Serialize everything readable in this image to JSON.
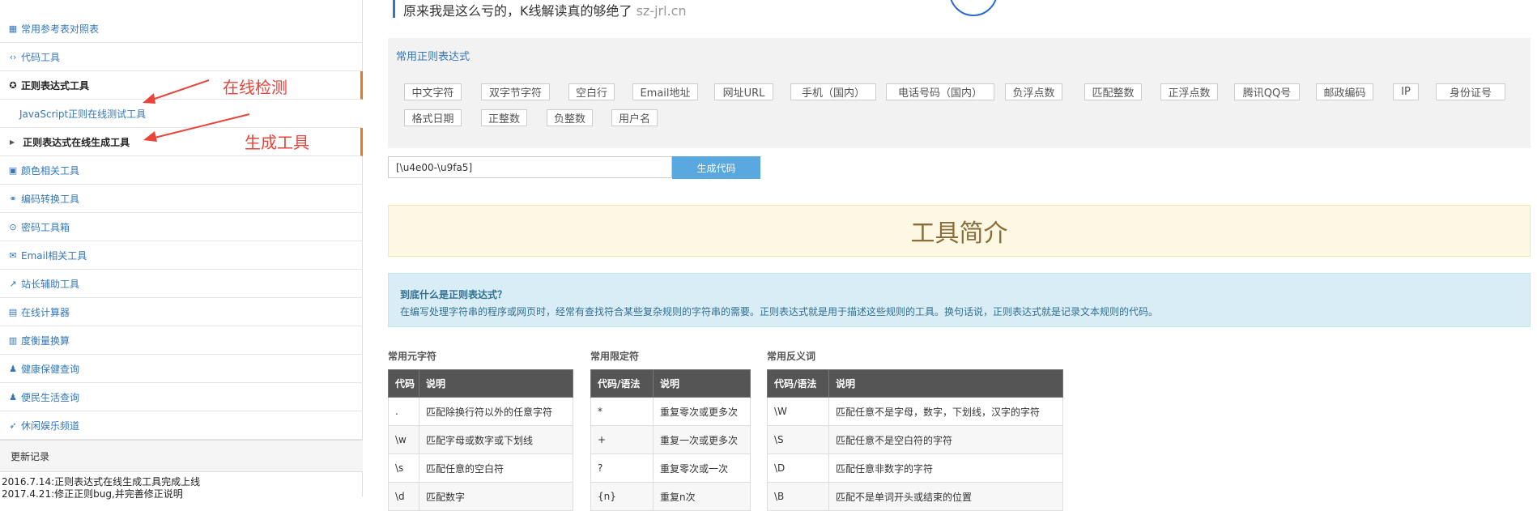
{
  "sidebar": {
    "items": [
      {
        "icon": "table-icon",
        "glyph": "▦",
        "label": "常用参考表对照表"
      },
      {
        "icon": "code-icon",
        "glyph": "‹›",
        "label": "代码工具"
      },
      {
        "icon": "regex-icon",
        "glyph": "✪",
        "label": "正则表达式工具"
      },
      {
        "icon": "palette-icon",
        "glyph": "▣",
        "label": "颜色相关工具"
      },
      {
        "icon": "convert-icon",
        "glyph": "⚭",
        "label": "编码转换工具"
      },
      {
        "icon": "password-icon",
        "glyph": "⊙",
        "label": "密码工具箱"
      },
      {
        "icon": "email-icon",
        "glyph": "✉",
        "label": "Email相关工具"
      },
      {
        "icon": "share-icon",
        "glyph": "↗",
        "label": "站长辅助工具"
      },
      {
        "icon": "calculator-icon",
        "glyph": "▤",
        "label": "在线计算器"
      },
      {
        "icon": "measure-icon",
        "glyph": "▥",
        "label": "度衡量换算"
      },
      {
        "icon": "health-icon",
        "glyph": "♟",
        "label": "健康保健查询"
      },
      {
        "icon": "life-icon",
        "glyph": "♟",
        "label": "便民生活查询"
      },
      {
        "icon": "game-icon",
        "glyph": "➶",
        "label": "休闲娱乐频道"
      }
    ],
    "sub_items": [
      {
        "label": "JavaScript正则在线测试工具"
      },
      {
        "label": "正则表达式在线生成工具"
      }
    ],
    "log_title": "更新记录",
    "log_lines": [
      "2016.7.14:正则表达式在线生成工具完成上线",
      "2017.4.21:修正正则bug,并完善修正说明"
    ]
  },
  "annotations": {
    "online_check": "在线检测",
    "generator": "生成工具",
    "color": "#e8443a"
  },
  "banner": {
    "text": "原来我是这么亏的，K线解读真的够绝了",
    "url": "sz-jrl.cn"
  },
  "regex_panel": {
    "title": "常用正则表达式",
    "chips": [
      "中文字符",
      "双字节字符",
      "空白行",
      "Email地址",
      "网址URL",
      "手机（国内）",
      "电话号码（国内）",
      "负浮点数",
      "匹配整数",
      "正浮点数",
      "腾讯QQ号",
      "邮政编码",
      "IP",
      "身份证号",
      "格式日期",
      "正整数",
      "负整数",
      "用户名"
    ]
  },
  "generator": {
    "input_value": "[\\u4e00-\\u9fa5]",
    "button_label": "生成代码"
  },
  "intro": {
    "title": "工具简介",
    "question": "到底什么是正则表达式？",
    "answer": "在编写处理字符串的程序或网页时，经常有查找符合某些复杂规则的字符串的需要。正则表达式就是用于描述这些规则的工具。换句话说，正则表达式就是记录文本规则的代码。"
  },
  "tables": {
    "meta": {
      "title": "常用元字符",
      "headers": [
        "代码",
        "说明"
      ],
      "rows": [
        [
          ".",
          "匹配除换行符以外的任意字符"
        ],
        [
          "\\w",
          "匹配字母或数字或下划线"
        ],
        [
          "\\s",
          "匹配任意的空白符"
        ],
        [
          "\\d",
          "匹配数字"
        ]
      ]
    },
    "quant": {
      "title": "常用限定符",
      "headers": [
        "代码/语法",
        "说明"
      ],
      "rows": [
        [
          "*",
          "重复零次或更多次"
        ],
        [
          "+",
          "重复一次或更多次"
        ],
        [
          "?",
          "重复零次或一次"
        ],
        [
          "{n}",
          "重复n次"
        ]
      ]
    },
    "neg": {
      "title": "常用反义词",
      "headers": [
        "代码/语法",
        "说明"
      ],
      "rows": [
        [
          "\\W",
          "匹配任意不是字母，数字，下划线，汉字的字符"
        ],
        [
          "\\S",
          "匹配任意不是空白符的字符"
        ],
        [
          "\\D",
          "匹配任意非数字的字符"
        ],
        [
          "\\B",
          "匹配不是单词开头或结束的位置"
        ]
      ]
    }
  }
}
